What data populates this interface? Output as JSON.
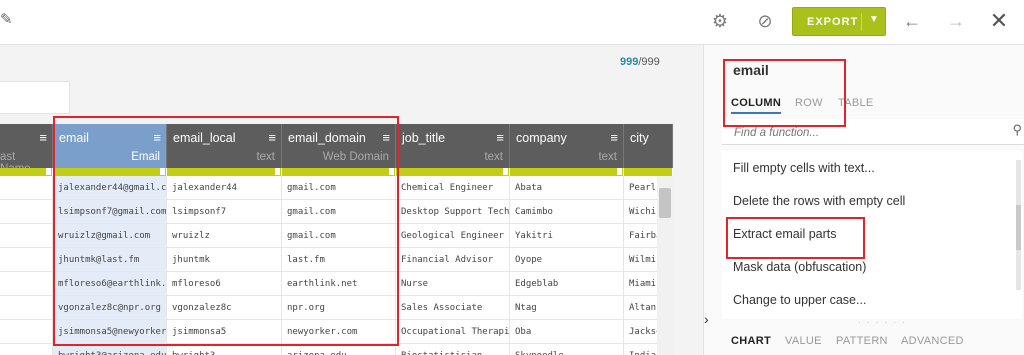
{
  "toolbar": {
    "export_label": "EXPORT",
    "icons": [
      "pencil-icon",
      "gear-icon",
      "link-icon",
      "chevron-down-icon",
      "arrow-left-icon",
      "arrow-right-icon",
      "close-icon"
    ]
  },
  "counter": {
    "valid": "999",
    "total": "/999"
  },
  "columns": [
    {
      "name": "",
      "type": "ast Name",
      "cells": [
        "",
        "",
        "",
        "",
        "",
        "",
        "",
        ""
      ]
    },
    {
      "name": "email",
      "type": "Email",
      "cells": [
        "jalexander44@gmail.cc",
        "lsimpsonf7@gmail.com",
        "wruizlz@gmail.com",
        "jhuntmk@last.fm",
        "mfloreso6@earthlink.n",
        "vgonzalez8c@npr.org",
        "jsimmonsa5@newyorker.",
        "bwright3@arizona.edu"
      ]
    },
    {
      "name": "email_local",
      "type": "text",
      "cells": [
        "jalexander44",
        "lsimpsonf7",
        "wruizlz",
        "jhuntmk",
        "mfloreso6",
        "vgonzalez8c",
        "jsimmonsa5",
        "bwright3"
      ]
    },
    {
      "name": "email_domain",
      "type": "Web Domain",
      "cells": [
        "gmail.com",
        "gmail.com",
        "gmail.com",
        "last.fm",
        "earthlink.net",
        "npr.org",
        "newyorker.com",
        "arizona.edu"
      ]
    },
    {
      "name": "job_title",
      "type": "text",
      "cells": [
        "Chemical Engineer",
        "Desktop Support Techn",
        "Geological Engineer",
        "Financial Advisor",
        "Nurse",
        "Sales Associate",
        "Occupational Therapis",
        "Biostatistician"
      ]
    },
    {
      "name": "company",
      "type": "text",
      "cells": [
        "Abata",
        "Camimbo",
        "Yakitri",
        "Oyope",
        "Edgeblab",
        "Ntag",
        "Oba",
        "Skynoodle"
      ]
    },
    {
      "name": "city",
      "type": "",
      "cells": [
        "Pearl",
        "Wichi",
        "Fairba",
        "Wilmin",
        "Miami",
        "Altan",
        "Jackso",
        "India"
      ]
    }
  ],
  "panel": {
    "title": "email",
    "tabs": [
      "COLUMN",
      "ROW",
      "TABLE"
    ],
    "search_placeholder": "Find a function...",
    "functions": [
      "Fill empty cells with text...",
      "Delete the rows with empty cell",
      "Extract email parts",
      "Mask data (obfuscation)",
      "Change to upper case..."
    ],
    "bottom_tabs": [
      "CHART",
      "VALUE",
      "PATTERN",
      "ADVANCED"
    ]
  },
  "colors": {
    "accent": "#a9c11a",
    "selected_column": "#7b9fcb",
    "quality_bar": "#c2ce15",
    "highlight_box": "#e0242c"
  }
}
